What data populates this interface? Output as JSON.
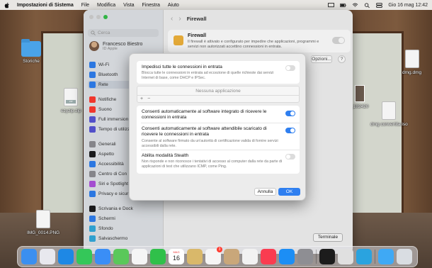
{
  "menubar": {
    "app_name": "Impostazioni di Sistema",
    "items": [
      "File",
      "Modifica",
      "Vista",
      "Finestra",
      "Aiuto"
    ],
    "clock": "Gio 16 mag  12:42"
  },
  "desktop_icons": {
    "storiche": "Storiche",
    "ezyzip": "ezyzip.zip",
    "img": "IMG_0014.PNG",
    "dmg": "dmg.dmg",
    "partial": "_182420",
    "dmg_convertita": "dmg convertita.iso"
  },
  "settings": {
    "search_placeholder": "Cerca",
    "user_name": "Francesco Biestro",
    "user_sub": "ID Apple",
    "sidebar": [
      {
        "label": "Wi-Fi",
        "color": "#2f7ff0"
      },
      {
        "label": "Bluetooth",
        "color": "#2f7ff0"
      },
      {
        "label": "Rete",
        "color": "#2f7ff0",
        "selected": true
      },
      {
        "label": "Notifiche",
        "color": "#ff3b30"
      },
      {
        "label": "Suono",
        "color": "#ff3b30"
      },
      {
        "label": "Full immersion",
        "color": "#5856d6"
      },
      {
        "label": "Tempo di utilizzo",
        "color": "#5856d6"
      },
      {
        "label": "Generali",
        "color": "#8e8e93"
      },
      {
        "label": "Aspetto",
        "color": "#1c1c1e"
      },
      {
        "label": "Accessibilità",
        "color": "#2f7ff0"
      },
      {
        "label": "Centro di Con",
        "color": "#8e8e93"
      },
      {
        "label": "Siri e Spotlight",
        "color": "#af52de"
      },
      {
        "label": "Privacy e sicur",
        "color": "#2f7ff0"
      },
      {
        "label": "Scrivania e Dock",
        "color": "#1c1c1e"
      },
      {
        "label": "Schermi",
        "color": "#2f7ff0"
      },
      {
        "label": "Sfondo",
        "color": "#34aadc"
      },
      {
        "label": "Salvaschermo",
        "color": "#34aadc"
      }
    ],
    "page_title": "Firewall",
    "fw_title": "Firewall",
    "fw_desc": "Il firewall è attivato e configurato per impedire che applicazioni, programmi e servizi non autorizzati accettino connessioni in entrata.",
    "options_label": "Opzioni...",
    "help_label": "?"
  },
  "sheet": {
    "block_all_title": "Impedisci tutte le connessioni in entrata",
    "block_all_desc": "Blocca tutte le connessioni in entrata ad eccezione di quelle richieste dai servizi Internet di base, come DHCP e IPSec.",
    "block_all_on": false,
    "no_app": "Nessuna applicazione",
    "add_symbol": "+",
    "remove_symbol": "−",
    "builtin_title": "Consenti automaticamente al software integrato di ricevere le connessioni in entrata",
    "builtin_on": true,
    "signed_title": "Consenti automaticamente al software attendibile scaricato di ricevere le connessioni in entrata",
    "signed_desc": "Consente al software firmato da un'autorità di certificazione valida di fornire servizi accessibili dalla rete.",
    "signed_on": true,
    "stealth_title": "Abilita modalità Stealth",
    "stealth_desc": "Non risponde e non riconosce i tentativi di accesso al computer dalla rete da parte di applicazioni di test che utilizzano ICMP, come Ping.",
    "stealth_on": false,
    "cancel_label": "Annulla",
    "ok_label": "OK"
  },
  "dock": {
    "tooltip": "Terminale",
    "calendar_month": "MAG",
    "calendar_day": "16",
    "badge_count": "3",
    "items": [
      {
        "name": "finder-icon",
        "color": "#3b8ff0"
      },
      {
        "name": "launchpad-icon",
        "color": "#e8e8ee"
      },
      {
        "name": "safari-icon",
        "color": "#1e88e5"
      },
      {
        "name": "messages-icon",
        "color": "#34c759"
      },
      {
        "name": "mail-icon",
        "color": "#3a8ef6"
      },
      {
        "name": "maps-icon",
        "color": "#5ac85a"
      },
      {
        "name": "photos-icon",
        "color": "#f5f5f5"
      },
      {
        "name": "facetime-icon",
        "color": "#30c04a"
      },
      {
        "name": "calendar-icon",
        "color": "#ffffff"
      },
      {
        "name": "notes-icon",
        "color": "#d9b86a"
      },
      {
        "name": "reminders-icon",
        "color": "#f5f5f5"
      },
      {
        "name": "contacts-icon",
        "color": "#c9a77a"
      },
      {
        "name": "freeform-icon",
        "color": "#f2f2f2"
      },
      {
        "name": "music-icon",
        "color": "#fa3c50"
      },
      {
        "name": "app-store-icon",
        "color": "#1c8ef5"
      },
      {
        "name": "system-settings-icon",
        "color": "#8e8e93"
      },
      {
        "name": "terminal-icon",
        "color": "#1c1c1c"
      },
      {
        "name": "preview-icon",
        "color": "#e0e0e0"
      },
      {
        "name": "telegram-icon",
        "color": "#2aa3df"
      },
      {
        "name": "downloads-icon",
        "color": "#3fa9f5"
      },
      {
        "name": "trash-icon",
        "color": "#d9dde2"
      }
    ]
  }
}
